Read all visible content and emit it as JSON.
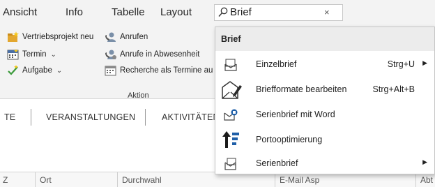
{
  "ribbon_tabs": [
    "Ansicht",
    "Info",
    "Tabelle",
    "Layout"
  ],
  "search": {
    "value": "Brief",
    "icon": "search-icon",
    "clear_label": "×"
  },
  "ribbon": {
    "buttons": [
      {
        "label": "Vertriebsprojekt neu",
        "icon": "project-icon"
      },
      {
        "label": "Termin",
        "icon": "calendar-icon",
        "dropdown": "⌄"
      },
      {
        "label": "Aufgabe",
        "icon": "task-icon",
        "dropdown": "⌄"
      },
      {
        "label": "Anrufen",
        "icon": "call-icon"
      },
      {
        "label": "Anrufe in Abwesenheit",
        "icon": "missed-call-icon"
      },
      {
        "label": "Recherche als Termine au",
        "icon": "research-calendar-icon"
      }
    ],
    "group_label": "Aktion"
  },
  "section_tabs": [
    "TE",
    "VERANSTALTUNGEN",
    "AKTIVITÄTEN"
  ],
  "grid_columns": [
    "Z",
    "Ort",
    "Durchwahl",
    "E-Mail Asp",
    "Abt"
  ],
  "dropdown": {
    "header": "Brief",
    "items": [
      {
        "label": "Einzelbrief",
        "shortcut": "Strg+U",
        "submenu": "▶",
        "icon": "letter-envelope-icon"
      },
      {
        "label": "Briefformate bearbeiten",
        "shortcut": "Strg+Alt+B",
        "icon": "edit-letter-format-icon"
      },
      {
        "label": "Serienbrief mit Word",
        "icon": "word-mail-merge-icon"
      },
      {
        "label": "Portooptimierung",
        "icon": "postage-optimization-icon"
      },
      {
        "label": "Serienbrief",
        "submenu": "▶",
        "icon": "mail-merge-icon"
      }
    ]
  },
  "colors": {
    "ribbon_bg": "#f3f3f3",
    "dropdown_header_bg": "#ececec",
    "accent_blue": "#1f5fa8"
  }
}
